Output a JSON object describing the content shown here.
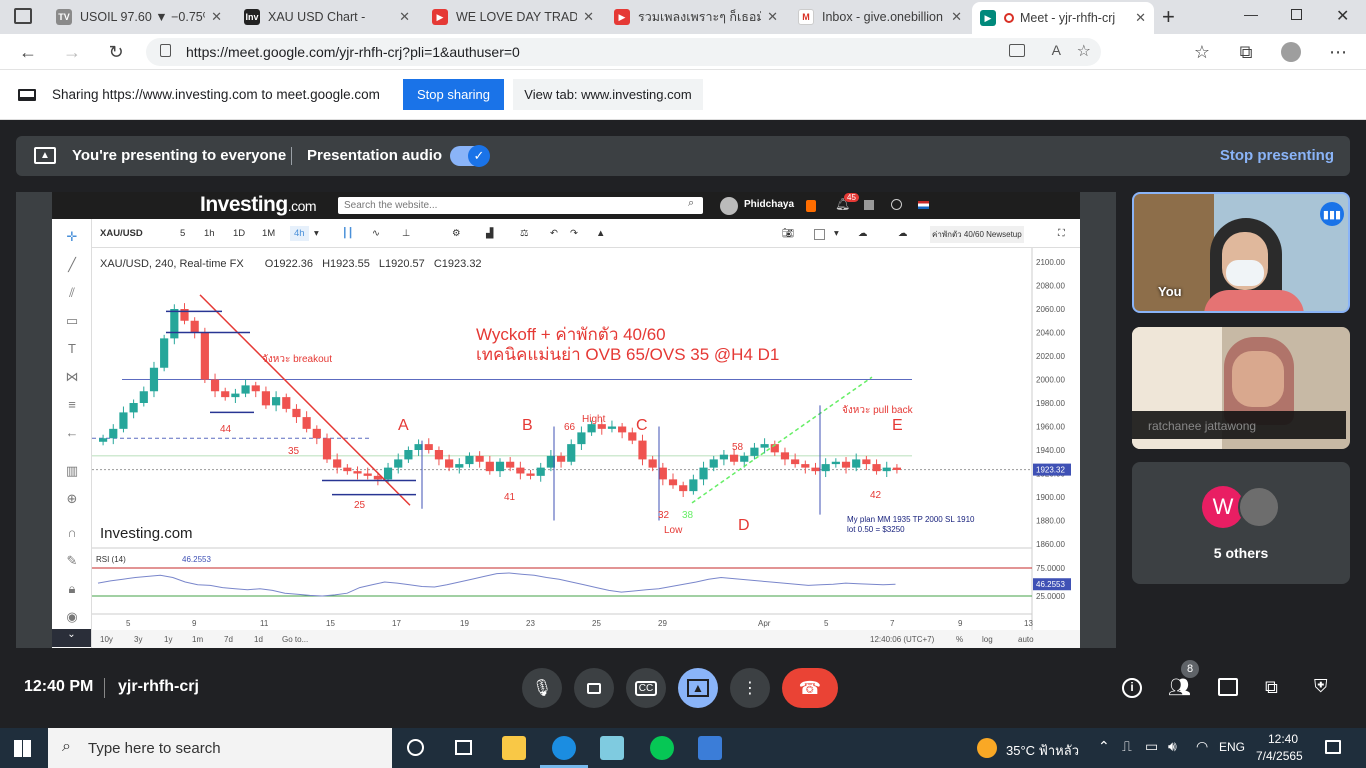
{
  "tabs": [
    {
      "title": "USOIL 97.60 ▼ −0.75%",
      "icon": "tradingview-icon"
    },
    {
      "title": "XAU USD Chart -",
      "icon": "investing-icon"
    },
    {
      "title": "WE LOVE DAY TRADE",
      "icon": "youtube-icon"
    },
    {
      "title": "รวมเพลงเพราะๆ ก็เธอมันส",
      "icon": "youtube-icon"
    },
    {
      "title": "Inbox - give.onebillion",
      "icon": "gmail-icon"
    },
    {
      "title": "Meet - yjr-rhfh-crj",
      "icon": "meet-icon"
    }
  ],
  "address": {
    "url": "https://meet.google.com/yjr-rhfh-crj?pli=1&authuser=0"
  },
  "share_bar": {
    "message": "Sharing https://www.investing.com to meet.google.com",
    "stop_label": "Stop sharing",
    "view_tab_label": "View tab: www.investing.com"
  },
  "presenting": {
    "status": "You're presenting to everyone",
    "audio_label": "Presentation audio",
    "stop_label": "Stop presenting"
  },
  "investing": {
    "logo": "Investing",
    "logo_suffix": ".com",
    "search_placeholder": "Search the website...",
    "user": "Phidchaya",
    "notif_count": "45",
    "symbol": "XAU/USD",
    "intervals": [
      "5",
      "1h",
      "1D",
      "1M",
      "4h"
    ],
    "layout_name": "ค่าพักตัว 40/60 Newsetup",
    "ohlc": {
      "title": "XAU/USD, 240, Real-time FX",
      "o": "O1922.36",
      "h": "H1923.55",
      "l": "L1920.57",
      "c": "C1923.32"
    },
    "watermark": "Investing.com",
    "ranges": [
      "10y",
      "3y",
      "1y",
      "1m",
      "7d",
      "1d",
      "Go to..."
    ],
    "clock": "12:40:06 (UTC+7)",
    "right_options": [
      "%",
      "log",
      "auto"
    ]
  },
  "chart_data": {
    "type": "candlestick",
    "title": "XAU/USD, 240, Real-time FX",
    "price_ticks": [
      "2100.00",
      "2080.00",
      "2060.00",
      "2040.00",
      "2020.00",
      "2000.00",
      "1980.00",
      "1960.00",
      "1940.00",
      "1920.00",
      "1900.00",
      "1880.00",
      "1860.00"
    ],
    "last_price": "1923.32",
    "x_ticks": [
      "5",
      "9",
      "11",
      "15",
      "17",
      "19",
      "23",
      "25",
      "29",
      "Apr",
      "5",
      "7",
      "9",
      "13"
    ],
    "annotations": {
      "headline1": "Wyckoff + ค่าพักตัว 40/60",
      "headline2": "เทคนิคแม่นย่า OVB 65/OVS 35 @H4 D1",
      "breakout": "จังหวะ breakout",
      "pullback": "จังหวะ pull back",
      "plan1": "My plan MM 1935 TP 2000 SL 1910",
      "plan2": "lot 0.50 = $3250",
      "points": [
        "A",
        "B",
        "C",
        "D",
        "E"
      ],
      "hight": "Hight",
      "low": "Low",
      "rsi_marks": [
        "44",
        "35",
        "25",
        "41",
        "66",
        "32",
        "38",
        "58",
        "42"
      ]
    },
    "close_path": [
      1950,
      1958,
      1972,
      1980,
      1990,
      2010,
      2035,
      2060,
      2050,
      2040,
      2000,
      1990,
      1985,
      1988,
      1995,
      1990,
      1978,
      1985,
      1975,
      1968,
      1958,
      1950,
      1932,
      1925,
      1922,
      1920,
      1918,
      1915,
      1925,
      1932,
      1940,
      1945,
      1940,
      1932,
      1925,
      1928,
      1935,
      1930,
      1922,
      1930,
      1925,
      1920,
      1918,
      1925,
      1935,
      1930,
      1945,
      1955,
      1962,
      1958,
      1960,
      1955,
      1948,
      1932,
      1925,
      1915,
      1910,
      1905,
      1915,
      1925,
      1932,
      1936,
      1930,
      1935,
      1942,
      1945,
      1938,
      1932,
      1928,
      1925,
      1922,
      1928,
      1930,
      1925,
      1932,
      1928,
      1922,
      1925,
      1923
    ]
  },
  "rsi": {
    "label": "RSI (14)",
    "value": "46.2553",
    "levels": [
      "75.0000",
      "25.0000"
    ],
    "values": [
      48,
      52,
      55,
      58,
      60,
      62,
      58,
      50,
      45,
      44,
      40,
      38,
      36,
      38,
      35,
      30,
      28,
      26,
      25,
      27,
      30,
      40,
      45,
      50,
      48,
      45,
      42,
      41,
      45,
      50,
      55,
      60,
      65,
      66,
      64,
      62,
      58,
      55,
      50,
      45,
      40,
      35,
      32,
      34,
      36,
      38,
      42,
      46,
      50,
      55,
      58,
      56,
      54,
      52,
      50,
      48,
      46,
      44,
      45,
      46,
      48,
      47,
      46,
      45,
      46
    ]
  },
  "participants": {
    "you_label": "You",
    "other_name": "ratchanee jattawong",
    "others_count_label": "5 others",
    "avatar_letter": "W",
    "people_badge": "8"
  },
  "meet_footer": {
    "time": "12:40 PM",
    "meeting_code": "yjr-rhfh-crj"
  },
  "taskbar": {
    "search_placeholder": "Type here to search",
    "weather": "35°C  ฟ้าหลัว",
    "lang": "ENG",
    "time": "12:40",
    "date": "7/4/2565"
  },
  "colors": {
    "accent": "#1a73e8",
    "meet_bg": "#202124",
    "meet_tile": "#3c4043",
    "end_call": "#ea4335",
    "candle_up": "#26a69a",
    "candle_down": "#ef5350",
    "annotation_red": "#e53935"
  }
}
